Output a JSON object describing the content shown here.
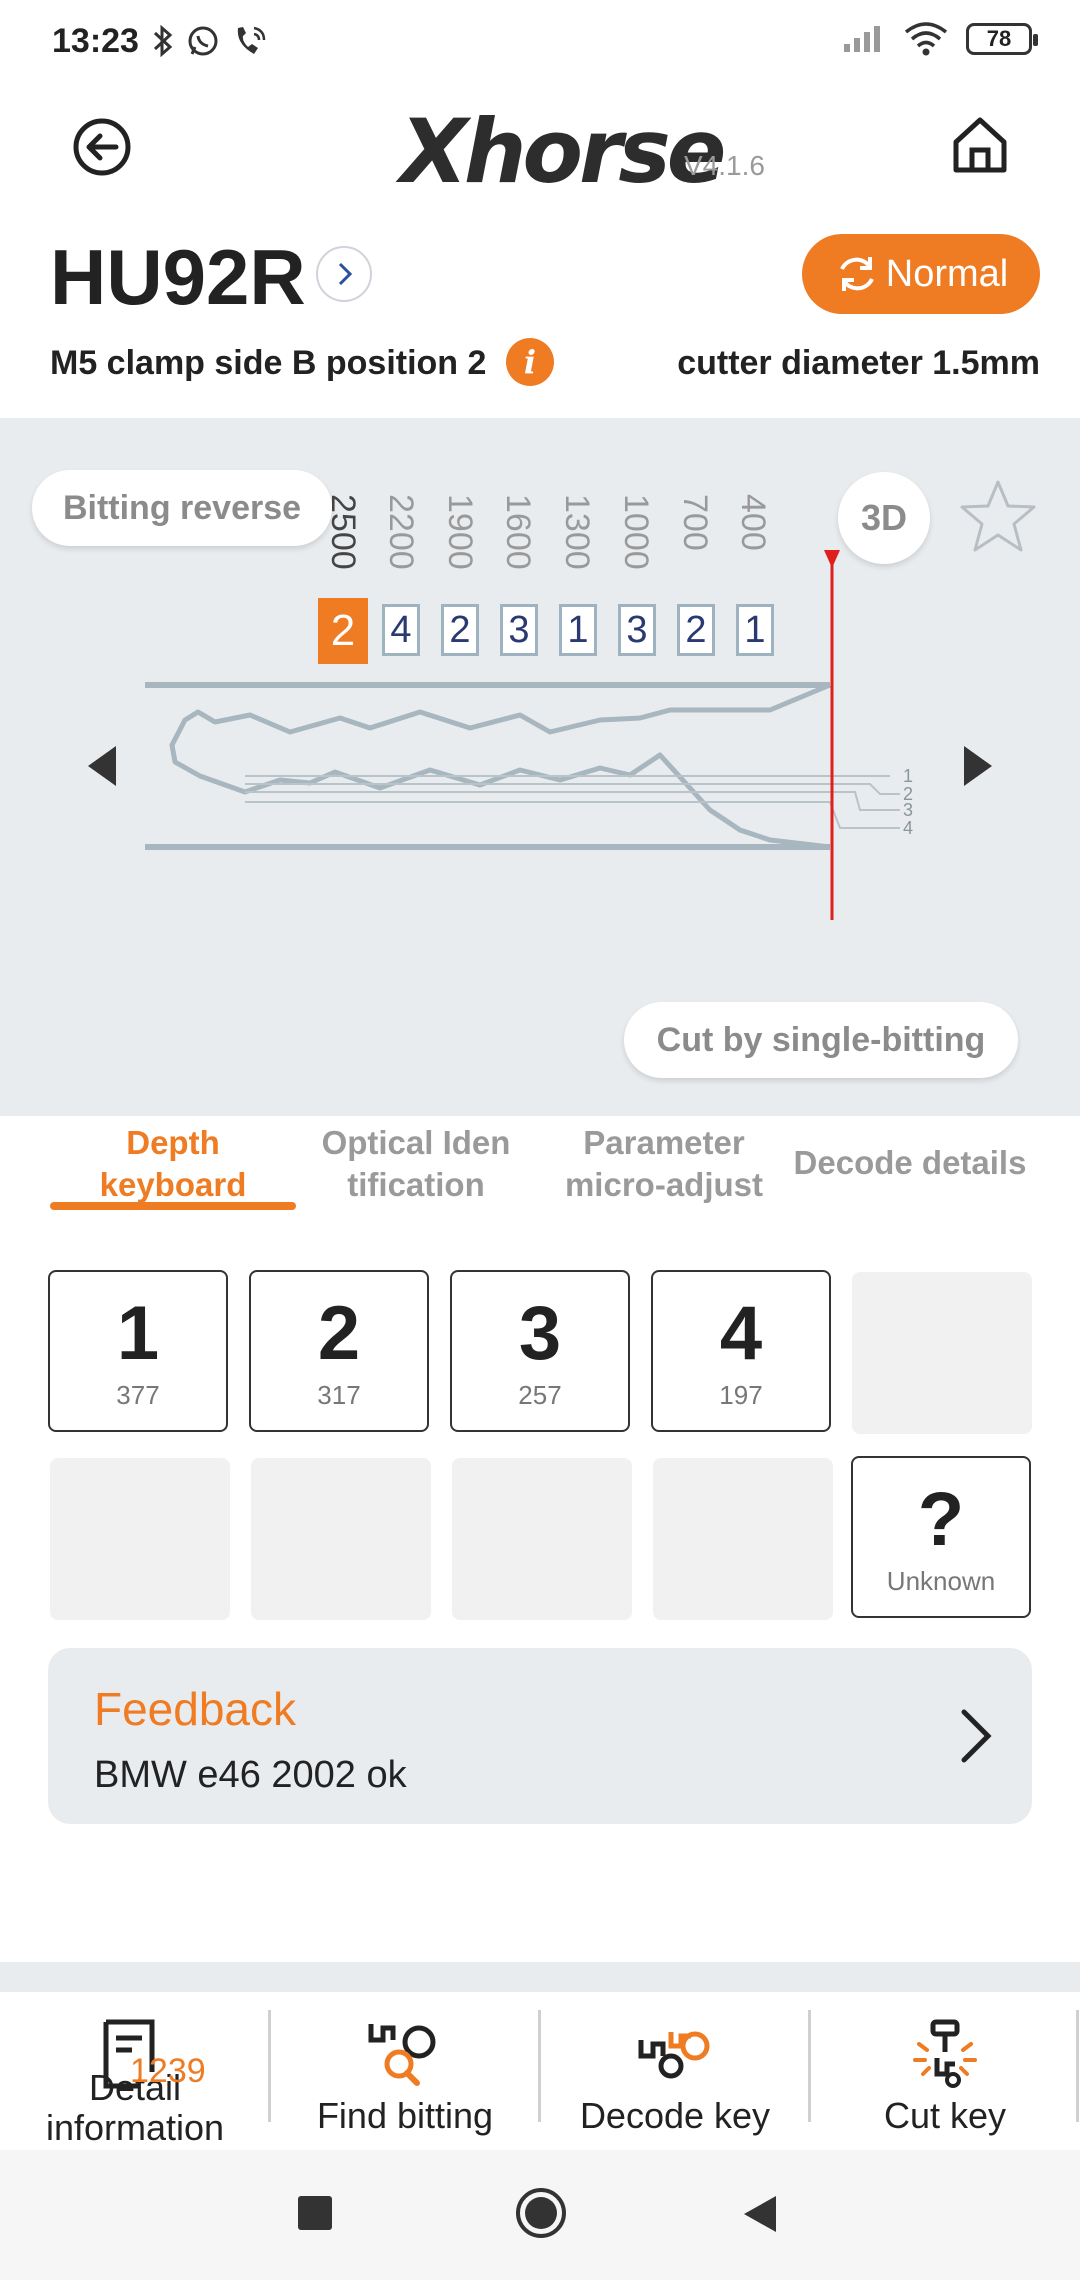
{
  "status_bar": {
    "time": "13:23",
    "battery": "78"
  },
  "header": {
    "logo": "Xhorse",
    "version": "V4.1.6",
    "back_icon": "back-arrow-icon",
    "home_icon": "home-icon"
  },
  "key_info": {
    "title": "HU92R",
    "mode_label": "Normal",
    "clamp": "M5 clamp side B position 2",
    "cutter": "cutter diameter 1.5mm"
  },
  "key_panel": {
    "bitting_reverse": "Bitting reverse",
    "btn_3d": "3D",
    "positions": [
      "2500",
      "2200",
      "1900",
      "1600",
      "1300",
      "1000",
      "700",
      "400"
    ],
    "depths": [
      "2",
      "4",
      "2",
      "3",
      "1",
      "3",
      "2",
      "1"
    ],
    "active_index": 0,
    "depth_levels": [
      "1",
      "2",
      "3",
      "4"
    ],
    "cut_single": "Cut by single-bitting"
  },
  "tabs": [
    {
      "label_line1": "Depth",
      "label_line2": "keyboard"
    },
    {
      "label_line1": "Optical Iden",
      "label_line2": "tification"
    },
    {
      "label_line1": "Parameter",
      "label_line2": "micro-adjust"
    },
    {
      "label_line1": "Decode details",
      "label_line2": ""
    }
  ],
  "keyboard": {
    "keys": [
      {
        "value": "1",
        "sub": "377"
      },
      {
        "value": "2",
        "sub": "317"
      },
      {
        "value": "3",
        "sub": "257"
      },
      {
        "value": "4",
        "sub": "197"
      }
    ],
    "unknown_symbol": "?",
    "unknown_label": "Unknown"
  },
  "feedback": {
    "title": "Feedback",
    "text": "BMW e46 2002 ok"
  },
  "bottom_nav": {
    "detail_count": "1239",
    "detail_label": "Detail information",
    "find_bitting": "Find bitting",
    "decode_key": "Decode key",
    "cut_key": "Cut key"
  },
  "colors": {
    "accent": "#ef7b22",
    "panel_bg": "#e9ecef",
    "cut_line": "#e01e1e"
  }
}
